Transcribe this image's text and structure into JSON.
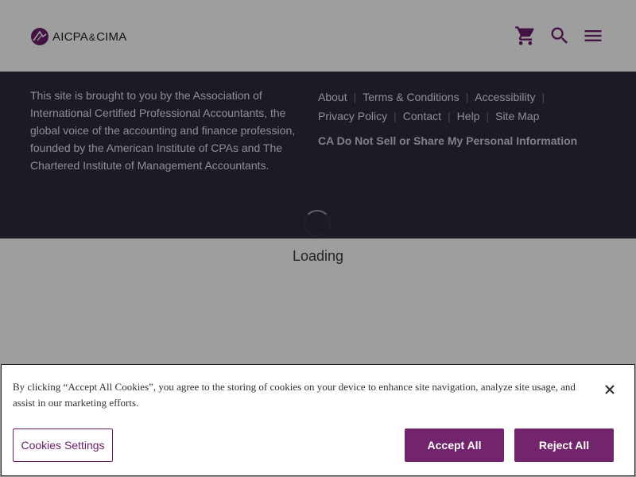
{
  "header": {
    "logo": {
      "text_left": "AICPA",
      "text_amp": "&",
      "text_right": "CIMA"
    },
    "icons": [
      "cart-icon",
      "search-icon",
      "menu-icon"
    ],
    "brand_color": "#6b1f6b"
  },
  "footer": {
    "description": "This site is brought to you by the Association of International Certified Professional Accountants, the global voice of the accounting and finance profession, founded by the American Institute of CPAs and The Chartered Institute of Management Accountants.",
    "links_row1": [
      "About",
      "Terms & Conditions",
      "Accessibility"
    ],
    "links_row2": [
      "Privacy Policy",
      "Contact",
      "Help",
      "Site Map"
    ],
    "ccpa_link": "CA Do Not Sell or Share My Personal Information",
    "background": "#2b2d3a"
  },
  "loading": {
    "text": "Loading"
  },
  "cookie_banner": {
    "message": "By clicking “Accept All Cookies”, you agree to the storing of cookies on your device to enhance site navigation, analyze site usage, and assist in our marketing efforts.",
    "settings_label": "Cookies Settings",
    "accept_label": "Accept All",
    "reject_label": "Reject All",
    "close_icon": "close-icon",
    "button_color": "#72246c"
  }
}
